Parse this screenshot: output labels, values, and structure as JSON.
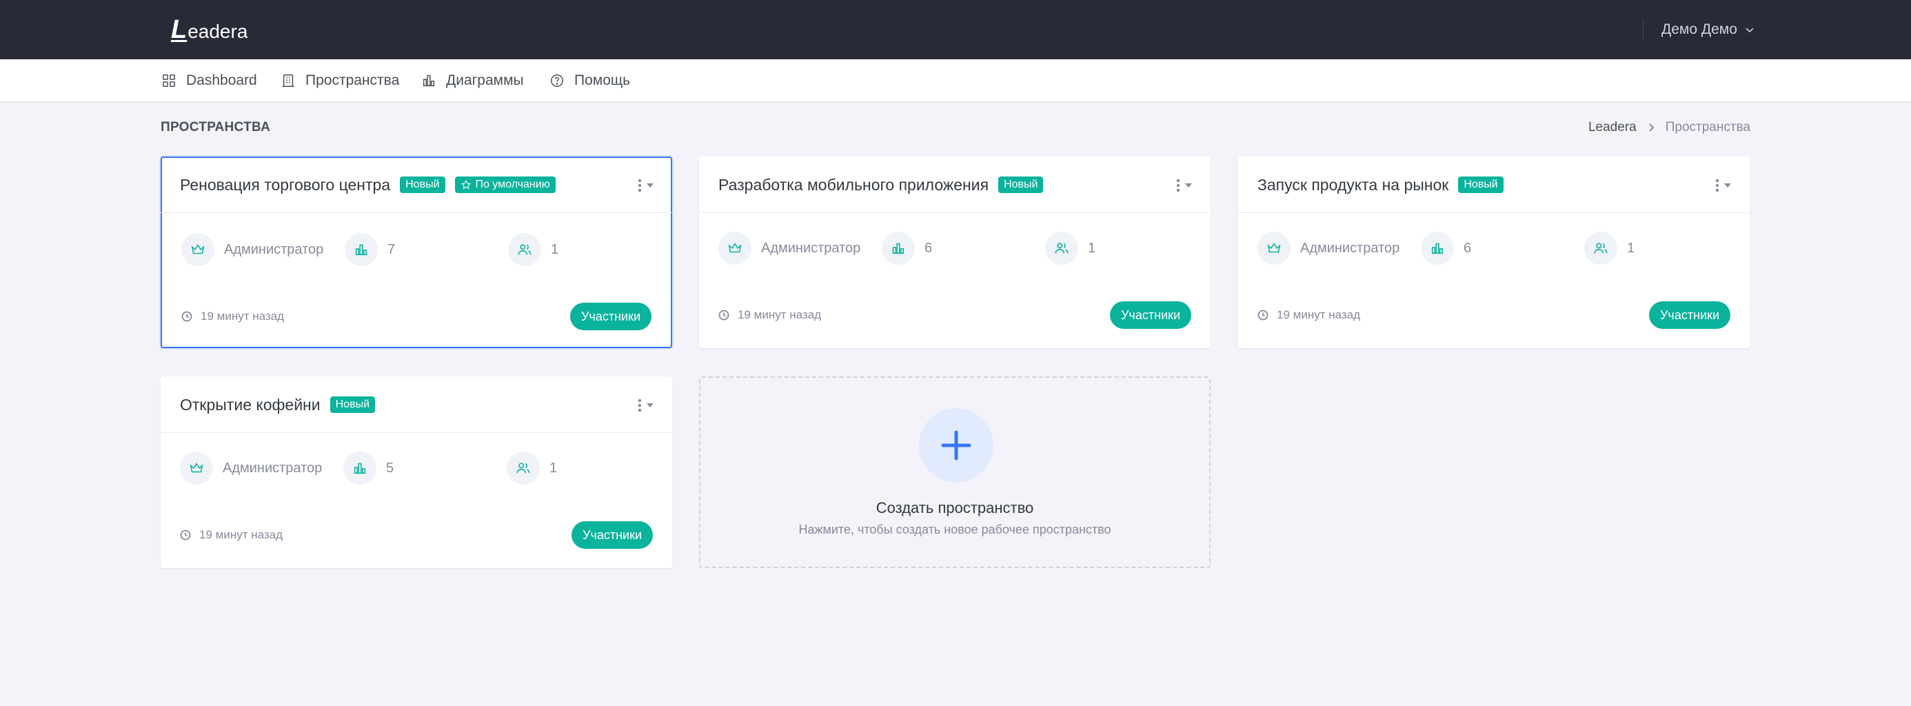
{
  "header": {
    "logo_initial": "L",
    "logo_rest": "eadera",
    "user_name": "Демо Демо"
  },
  "nav": [
    {
      "label": "Dashboard",
      "icon": "grid-icon"
    },
    {
      "label": "Пространства",
      "icon": "building-icon"
    },
    {
      "label": "Диаграммы",
      "icon": "chart-icon"
    },
    {
      "label": "Помощь",
      "icon": "help-icon"
    }
  ],
  "page": {
    "title": "ПРОСТРАНСТВА",
    "breadcrumb": [
      "Leadera",
      "Пространства"
    ]
  },
  "spaces": [
    {
      "title": "Реновация торгового центра",
      "badge": "Новый",
      "default_badge": "По умолчанию",
      "role": "Администратор",
      "diagrams": "7",
      "members": "1",
      "time": "19 минут назад",
      "button": "Участники",
      "selected": true
    },
    {
      "title": "Разработка мобильного приложения",
      "badge": "Новый",
      "role": "Администратор",
      "diagrams": "6",
      "members": "1",
      "time": "19 минут назад",
      "button": "Участники"
    },
    {
      "title": "Запуск продукта на рынок",
      "badge": "Новый",
      "role": "Администратор",
      "diagrams": "6",
      "members": "1",
      "time": "19 минут назад",
      "button": "Участники"
    },
    {
      "title": "Открытие кофейни",
      "badge": "Новый",
      "role": "Администратор",
      "diagrams": "5",
      "members": "1",
      "time": "19 минут назад",
      "button": "Участники"
    }
  ],
  "create": {
    "title": "Создать пространство",
    "subtitle": "Нажмите, чтобы создать новое рабочее пространство"
  },
  "colors": {
    "topbar": "#292a38",
    "accent_green": "#0ab39c",
    "accent_blue": "#3577f1",
    "background": "#f3f3f9"
  }
}
